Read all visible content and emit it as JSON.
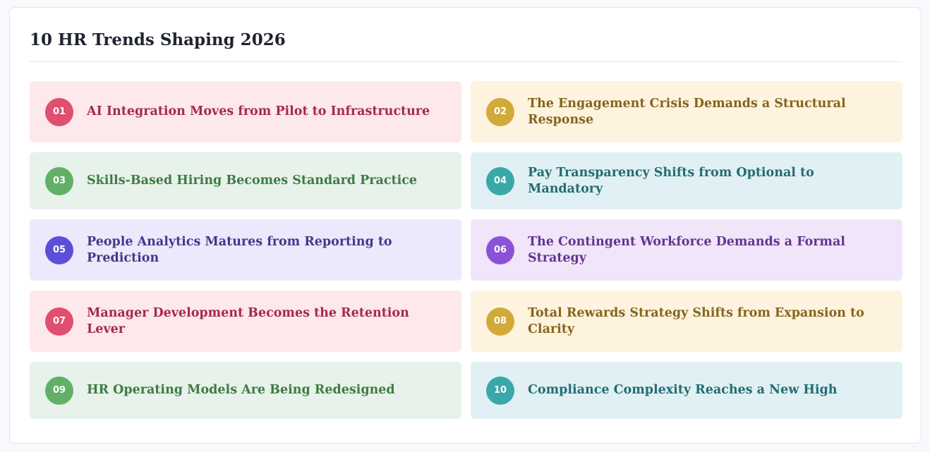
{
  "page": {
    "title": "10 HR Trends Shaping 2026"
  },
  "themes": {
    "pink": {
      "bg": "#fde8ec",
      "badge": "#e04e70",
      "text": "#a52a4a"
    },
    "gold": {
      "bg": "#fdf3df",
      "badge": "#d2aa3a",
      "text": "#84661c"
    },
    "green": {
      "bg": "#e6f2ea",
      "badge": "#62b066",
      "text": "#3f7b43"
    },
    "teal": {
      "bg": "#e1f0f4",
      "badge": "#3aa8a8",
      "text": "#226d72"
    },
    "indigo": {
      "bg": "#ebe9fb",
      "badge": "#5b4fd8",
      "text": "#413a8c"
    },
    "purple": {
      "bg": "#f1e5f9",
      "badge": "#8b52d8",
      "text": "#633591"
    }
  },
  "trends": [
    {
      "number": "01",
      "label": "AI Integration Moves from Pilot to Infrastructure",
      "theme": "pink"
    },
    {
      "number": "02",
      "label": "The Engagement Crisis Demands a Structural Response",
      "theme": "gold"
    },
    {
      "number": "03",
      "label": "Skills-Based Hiring Becomes Standard Practice",
      "theme": "green"
    },
    {
      "number": "04",
      "label": "Pay Transparency Shifts from Optional to Mandatory",
      "theme": "teal"
    },
    {
      "number": "05",
      "label": "People Analytics Matures from Reporting to Prediction",
      "theme": "indigo"
    },
    {
      "number": "06",
      "label": "The Contingent Workforce Demands a Formal Strategy",
      "theme": "purple"
    },
    {
      "number": "07",
      "label": "Manager Development Becomes the Retention Lever",
      "theme": "pink"
    },
    {
      "number": "08",
      "label": "Total Rewards Strategy Shifts from Expansion to Clarity",
      "theme": "gold"
    },
    {
      "number": "09",
      "label": "HR Operating Models Are Being Redesigned",
      "theme": "green"
    },
    {
      "number": "10",
      "label": "Compliance Complexity Reaches a New High",
      "theme": "teal"
    }
  ]
}
